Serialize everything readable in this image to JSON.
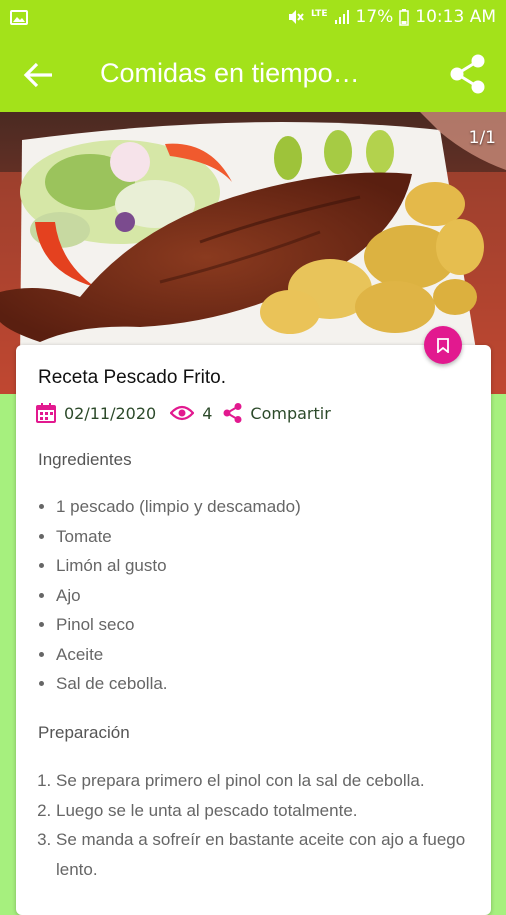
{
  "status_bar": {
    "battery": "17%",
    "time": "10:13 AM",
    "network": "LTE"
  },
  "app_bar": {
    "title": "Comidas en tiempo…"
  },
  "image": {
    "counter": "1/1"
  },
  "recipe": {
    "title": "Receta Pescado Frito.",
    "date": "02/11/2020",
    "views": "4",
    "share_label": "Compartir",
    "ingredients_heading": "Ingredientes",
    "ingredients": [
      "1 pescado (limpio y descamado)",
      "Tomate",
      "Limón al gusto",
      "Ajo",
      "Pinol seco",
      "Aceite",
      "Sal de cebolla."
    ],
    "preparation_heading": "Preparación",
    "steps": [
      "Se prepara primero el pinol con la sal de cebolla.",
      "Luego se le unta al pescado totalmente.",
      "Se manda a sofreír en bastante aceite con ajo a fuego lento."
    ]
  },
  "colors": {
    "app_bar": "#a3e21a",
    "background": "#a6f07e",
    "accent": "#e2198f",
    "meta_text": "#2c4a2a"
  },
  "icons": [
    "image-icon",
    "mute-icon",
    "signal-icon",
    "battery-icon",
    "back-arrow-icon",
    "share-icon",
    "bookmark-icon",
    "calendar-icon",
    "eye-icon",
    "share-small-icon"
  ]
}
